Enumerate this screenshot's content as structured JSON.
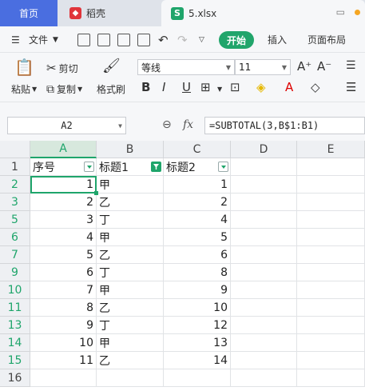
{
  "tabs": {
    "home": "首页",
    "docer": "稻壳",
    "file": "5.xlsx"
  },
  "menu": {
    "file": "文件",
    "start": "开始",
    "insert": "插入",
    "layout": "页面布局"
  },
  "ribbon": {
    "paste": "粘贴",
    "cut": "剪切",
    "copy": "复制",
    "format_painter": "格式刷",
    "font_name": "等线",
    "font_size": "11",
    "bold": "B",
    "italic": "I",
    "underline": "U"
  },
  "formula_bar": {
    "name_box": "A2",
    "fx": "fx",
    "formula": "=SUBTOTAL(3,B$1:B1)"
  },
  "columns": [
    "A",
    "B",
    "C",
    "D",
    "E"
  ],
  "rows": [
    "1",
    "2",
    "3",
    "5",
    "6",
    "7",
    "9",
    "10",
    "11",
    "13",
    "14",
    "15",
    "16"
  ],
  "header_row": [
    "序号",
    "标题1",
    "标题2"
  ],
  "data": [
    [
      "1",
      "甲",
      "1"
    ],
    [
      "2",
      "乙",
      "2"
    ],
    [
      "3",
      "丁",
      "4"
    ],
    [
      "4",
      "甲",
      "5"
    ],
    [
      "5",
      "乙",
      "6"
    ],
    [
      "6",
      "丁",
      "8"
    ],
    [
      "7",
      "甲",
      "9"
    ],
    [
      "8",
      "乙",
      "10"
    ],
    [
      "9",
      "丁",
      "12"
    ],
    [
      "10",
      "甲",
      "13"
    ],
    [
      "11",
      "乙",
      "14"
    ]
  ],
  "colors": {
    "accent": "#1fa56b",
    "tab_active": "#4a6ee0"
  }
}
